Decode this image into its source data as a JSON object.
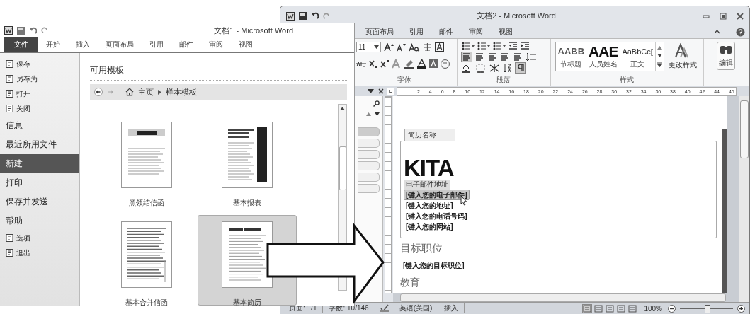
{
  "back_window": {
    "title": "文档2 - Microsoft Word",
    "tabs": [
      "页面布局",
      "引用",
      "邮件",
      "审阅",
      "视图"
    ],
    "font_size": "11",
    "groups": [
      "字体",
      "段落",
      "样式"
    ],
    "styles": [
      {
        "preview": "AABB",
        "name": "节标题",
        "kind": "heading"
      },
      {
        "preview": "AAE",
        "name": "人员姓名",
        "kind": "title"
      },
      {
        "preview": "AaBbCc[",
        "name": "正文",
        "kind": "normal"
      }
    ],
    "change_styles": "更改样式",
    "editing": "编辑",
    "ruler_marks": [
      "2",
      "4",
      "6",
      "8",
      "10",
      "12",
      "14",
      "16",
      "18",
      "20",
      "22",
      "24",
      "26",
      "28",
      "30",
      "32",
      "34",
      "36",
      "38",
      "40",
      "42",
      "44",
      "46"
    ],
    "document": {
      "title_control": "简历名称",
      "name": "KITA",
      "email_label": "电子邮件地址",
      "contact_lines": [
        {
          "text": "[键入您的电子邮件]",
          "selected": true
        },
        {
          "text": "[键入您的地址]",
          "selected": false
        },
        {
          "text": "[键入您的电话号码]",
          "selected": false
        },
        {
          "text": "[键入您的网站]",
          "selected": false
        }
      ],
      "heading": "目标职位",
      "objective": "[键入您的目标职位]",
      "heading_2": "教育"
    },
    "status_bar": {
      "page": "页面: 1/1",
      "words": "字数: 10/146",
      "language": "英语(美国)",
      "mode": "插入",
      "zoom": "100%",
      "zoom_slider": {
        "level": 0.5
      }
    }
  },
  "front_window": {
    "title": "文档1 - Microsoft Word",
    "tabs": [
      {
        "label": "文件",
        "selected": true
      },
      {
        "label": "开始",
        "selected": false
      },
      {
        "label": "插入",
        "selected": false
      },
      {
        "label": "页面布局",
        "selected": false
      },
      {
        "label": "引用",
        "selected": false
      },
      {
        "label": "邮件",
        "selected": false
      },
      {
        "label": "审阅",
        "selected": false
      },
      {
        "label": "视图",
        "selected": false
      }
    ],
    "menu": [
      {
        "label": "保存",
        "kind": "command",
        "selected": false
      },
      {
        "label": "另存为",
        "kind": "command",
        "selected": false
      },
      {
        "label": "打开",
        "kind": "command",
        "selected": false
      },
      {
        "label": "关闭",
        "kind": "command",
        "selected": false
      },
      {
        "label": "信息",
        "kind": "section",
        "selected": false
      },
      {
        "label": "最近所用文件",
        "kind": "section",
        "selected": false
      },
      {
        "label": "新建",
        "kind": "section",
        "selected": true
      },
      {
        "label": "打印",
        "kind": "section",
        "selected": false
      },
      {
        "label": "保存并发送",
        "kind": "section",
        "selected": false
      },
      {
        "label": "帮助",
        "kind": "section",
        "selected": false
      },
      {
        "label": "选项",
        "kind": "command",
        "selected": false
      },
      {
        "label": "退出",
        "kind": "command",
        "selected": false
      }
    ],
    "heading": "可用模板",
    "breadcrumb": [
      "主页",
      "样本模板"
    ],
    "templates": [
      {
        "name": "黑领结信函",
        "kind": "letter",
        "selected": false
      },
      {
        "name": "基本报表",
        "kind": "report",
        "selected": false
      },
      {
        "name": "基本合并信函",
        "kind": "merge",
        "selected": false
      },
      {
        "name": "基本简历",
        "kind": "resume",
        "selected": true
      }
    ]
  }
}
